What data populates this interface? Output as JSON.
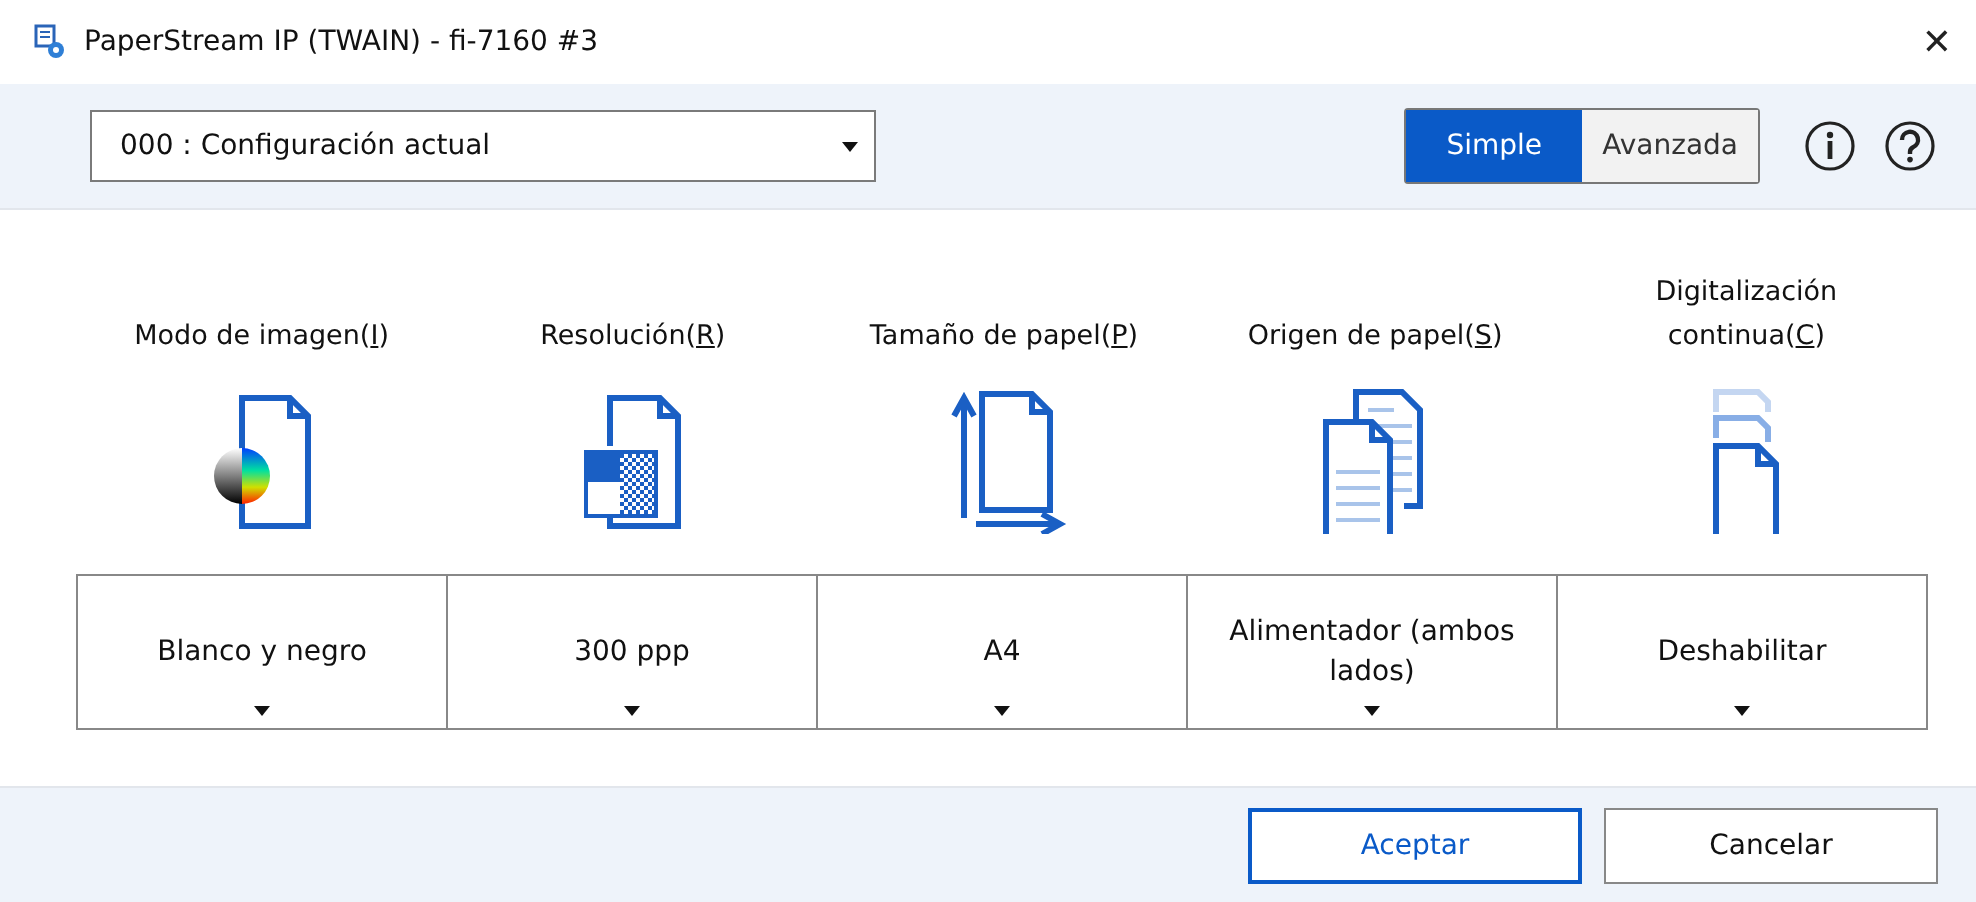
{
  "window": {
    "title": "PaperStream IP (TWAIN) - fi-7160 #3",
    "close": "✕"
  },
  "profile": {
    "value": "000 : Configuración actual"
  },
  "mode_tabs": [
    {
      "label": "Simple",
      "selected": true
    },
    {
      "label": "Avanzada",
      "selected": false
    }
  ],
  "settings": [
    {
      "label_before": "Modo de imagen(",
      "mnemonic": "I",
      "label_after": ")",
      "value": "Blanco y negro"
    },
    {
      "label_before": "Resolución(",
      "mnemonic": "R",
      "label_after": ")",
      "value": "300 ppp"
    },
    {
      "label_before": "Tamaño de papel(",
      "mnemonic": "P",
      "label_after": ")",
      "value": "A4"
    },
    {
      "label_before": "Origen de papel(",
      "mnemonic": "S",
      "label_after": ")",
      "value": "Alimentador (ambos lados)"
    },
    {
      "label_before": "Digitalización continua(",
      "mnemonic": "C",
      "label_after": ")",
      "value": "Deshabilitar"
    }
  ],
  "buttons": [
    {
      "label": "Aceptar",
      "default": true
    },
    {
      "label": "Cancelar",
      "default": false
    }
  ]
}
